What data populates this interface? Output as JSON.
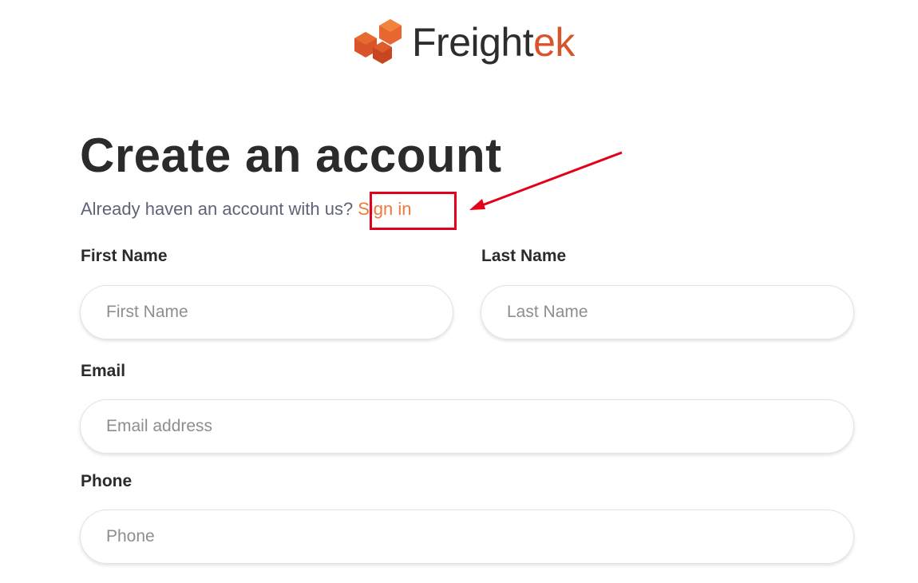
{
  "logo": {
    "text_part1": "Freight",
    "text_part2": "ek",
    "icon": "freightek-hexagon-logo-icon",
    "colors": {
      "dark": "#2d2d2d",
      "orange": "#d9542a"
    }
  },
  "page": {
    "title": "Create an account",
    "subtitle": "Already haven an account with us?",
    "signin_link": "Sign in"
  },
  "form": {
    "first_name": {
      "label": "First Name",
      "placeholder": "First Name",
      "value": ""
    },
    "last_name": {
      "label": "Last Name",
      "placeholder": "Last Name",
      "value": ""
    },
    "email": {
      "label": "Email",
      "placeholder": "Email address",
      "value": ""
    },
    "phone": {
      "label": "Phone",
      "placeholder": "Phone",
      "value": ""
    }
  },
  "annotation": {
    "type": "red-box-with-arrow",
    "target": "signin_link",
    "color": "#e3001b"
  },
  "colors": {
    "accent": "#ef7a39",
    "heading": "#2b2b2b",
    "subtext": "#5f6378"
  }
}
